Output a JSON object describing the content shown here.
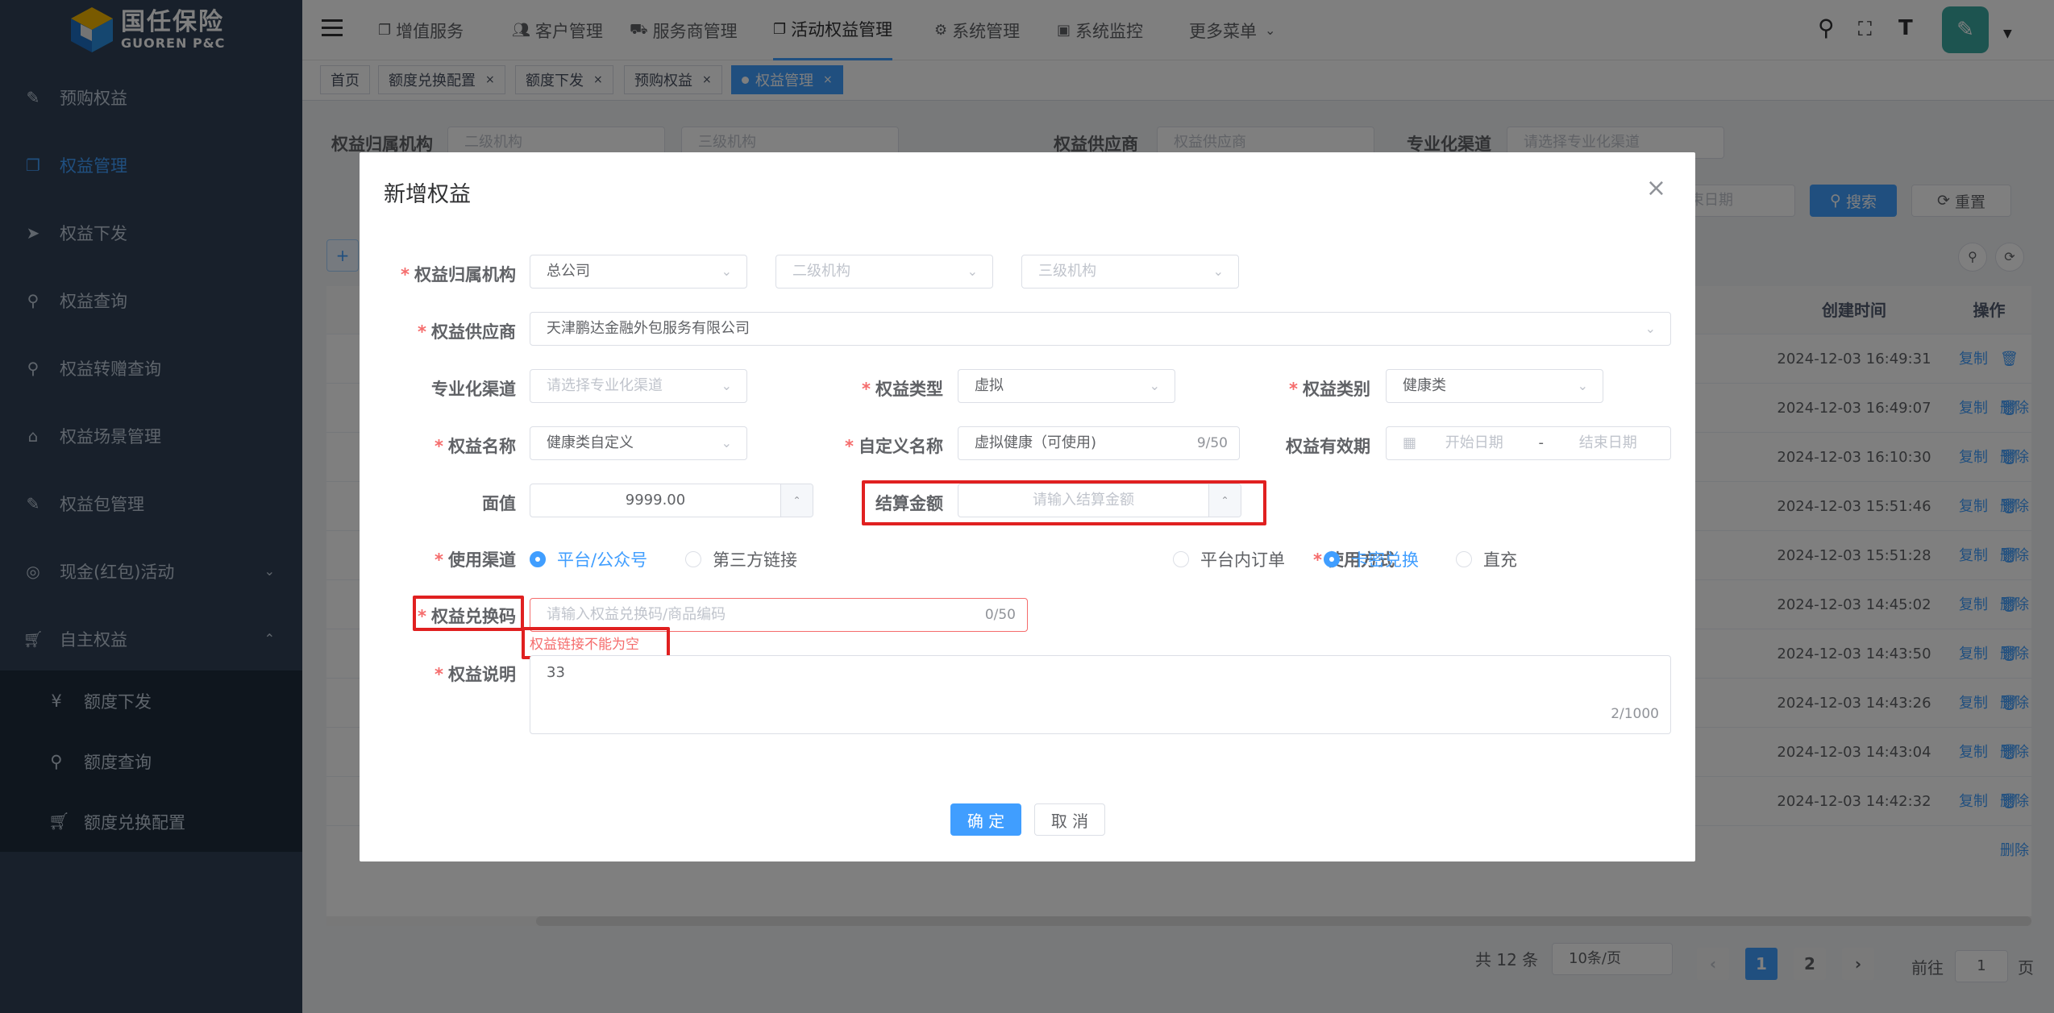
{
  "logo": {
    "title": "国任保险",
    "subtitle": "GUOREN P&C"
  },
  "sidebar": {
    "items": [
      {
        "label": "预购权益"
      },
      {
        "label": "权益管理"
      },
      {
        "label": "权益下发"
      },
      {
        "label": "权益查询"
      },
      {
        "label": "权益转赠查询"
      },
      {
        "label": "权益场景管理"
      },
      {
        "label": "权益包管理"
      },
      {
        "label": "现金(红包)活动"
      },
      {
        "label": "自主权益"
      }
    ],
    "sub_items": [
      {
        "label": "额度下发"
      },
      {
        "label": "额度查询"
      },
      {
        "label": "额度兑换配置"
      }
    ]
  },
  "nav": {
    "items": [
      {
        "label": "增值服务"
      },
      {
        "label": "客户管理"
      },
      {
        "label": "服务商管理"
      },
      {
        "label": "活动权益管理"
      },
      {
        "label": "系统管理"
      },
      {
        "label": "系统监控"
      },
      {
        "label": "更多菜单"
      }
    ]
  },
  "tags": [
    {
      "label": "首页"
    },
    {
      "label": "额度兑换配置"
    },
    {
      "label": "额度下发"
    },
    {
      "label": "预购权益"
    },
    {
      "label": "权益管理"
    }
  ],
  "filters": {
    "org_label": "权益归属机构",
    "org2_placeholder": "二级机构",
    "org3_placeholder": "三级机构",
    "supplier_label": "权益供应商",
    "supplier_placeholder": "权益供应商",
    "channel_label": "专业化渠道",
    "channel_placeholder": "请选择专业化渠道",
    "date_end_placeholder": "束日期",
    "search_label": "搜索",
    "reset_label": "重置"
  },
  "table": {
    "headers": {
      "created": "创建时间",
      "ops": "操作"
    },
    "copy_label": "复制",
    "delete_label": "删除",
    "rows": [
      {
        "created": "2024-12-03 16:49:31"
      },
      {
        "created": "2024-12-03 16:49:07"
      },
      {
        "created": "2024-12-03 16:10:30"
      },
      {
        "created": "2024-12-03 15:51:46"
      },
      {
        "created": "2024-12-03 15:51:28"
      },
      {
        "created": "2024-12-03 14:45:02"
      },
      {
        "created": "2024-12-03 14:43:50"
      },
      {
        "created": "2024-12-03 14:43:26"
      },
      {
        "created": "2024-12-03 14:43:04"
      },
      {
        "created": "2024-12-03 14:42:32"
      }
    ]
  },
  "pagination": {
    "total": "共 12 条",
    "page_size": "10条/页",
    "pages": [
      "1",
      "2"
    ],
    "goto_prefix": "前往",
    "goto_value": "1",
    "goto_suffix": "页"
  },
  "dialog": {
    "title": "新增权益",
    "fields": {
      "org_label": "权益归属机构",
      "org_value": "总公司",
      "org2_placeholder": "二级机构",
      "org3_placeholder": "三级机构",
      "supplier_label": "权益供应商",
      "supplier_value": "天津鹏达金融外包服务有限公司",
      "channel_label": "专业化渠道",
      "channel_placeholder": "请选择专业化渠道",
      "type_label": "权益类型",
      "type_value": "虚拟",
      "category_label": "权益类别",
      "category_value": "健康类",
      "name_label": "权益名称",
      "name_value": "健康类自定义",
      "custom_name_label": "自定义名称",
      "custom_name_value": "虚拟健康（可使用)",
      "custom_name_count": "9/50",
      "validity_label": "权益有效期",
      "validity_start_placeholder": "开始日期",
      "validity_sep": "-",
      "validity_end_placeholder": "结束日期",
      "face_label": "面值",
      "face_value": "9999.00",
      "settle_label": "结算金额",
      "settle_placeholder": "请输入结算金额",
      "use_channel_label": "使用渠道",
      "use_channel_options": [
        "平台/公众号",
        "第三方链接"
      ],
      "use_method_label": "使用方式",
      "use_method_options": [
        "平台内订单",
        "卡密兑换",
        "直充"
      ],
      "code_label": "权益兑换码",
      "code_placeholder": "请输入权益兑换码/商品编码",
      "code_count": "0/50",
      "code_error": "权益链接不能为空",
      "desc_label": "权益说明",
      "desc_value": "33",
      "desc_count": "2/1000"
    },
    "confirm_label": "确 定",
    "cancel_label": "取 消"
  },
  "colors": {
    "primary": "#409eff",
    "danger": "#f56c6c",
    "sidebar": "#304156",
    "highlight": "#e02020"
  }
}
